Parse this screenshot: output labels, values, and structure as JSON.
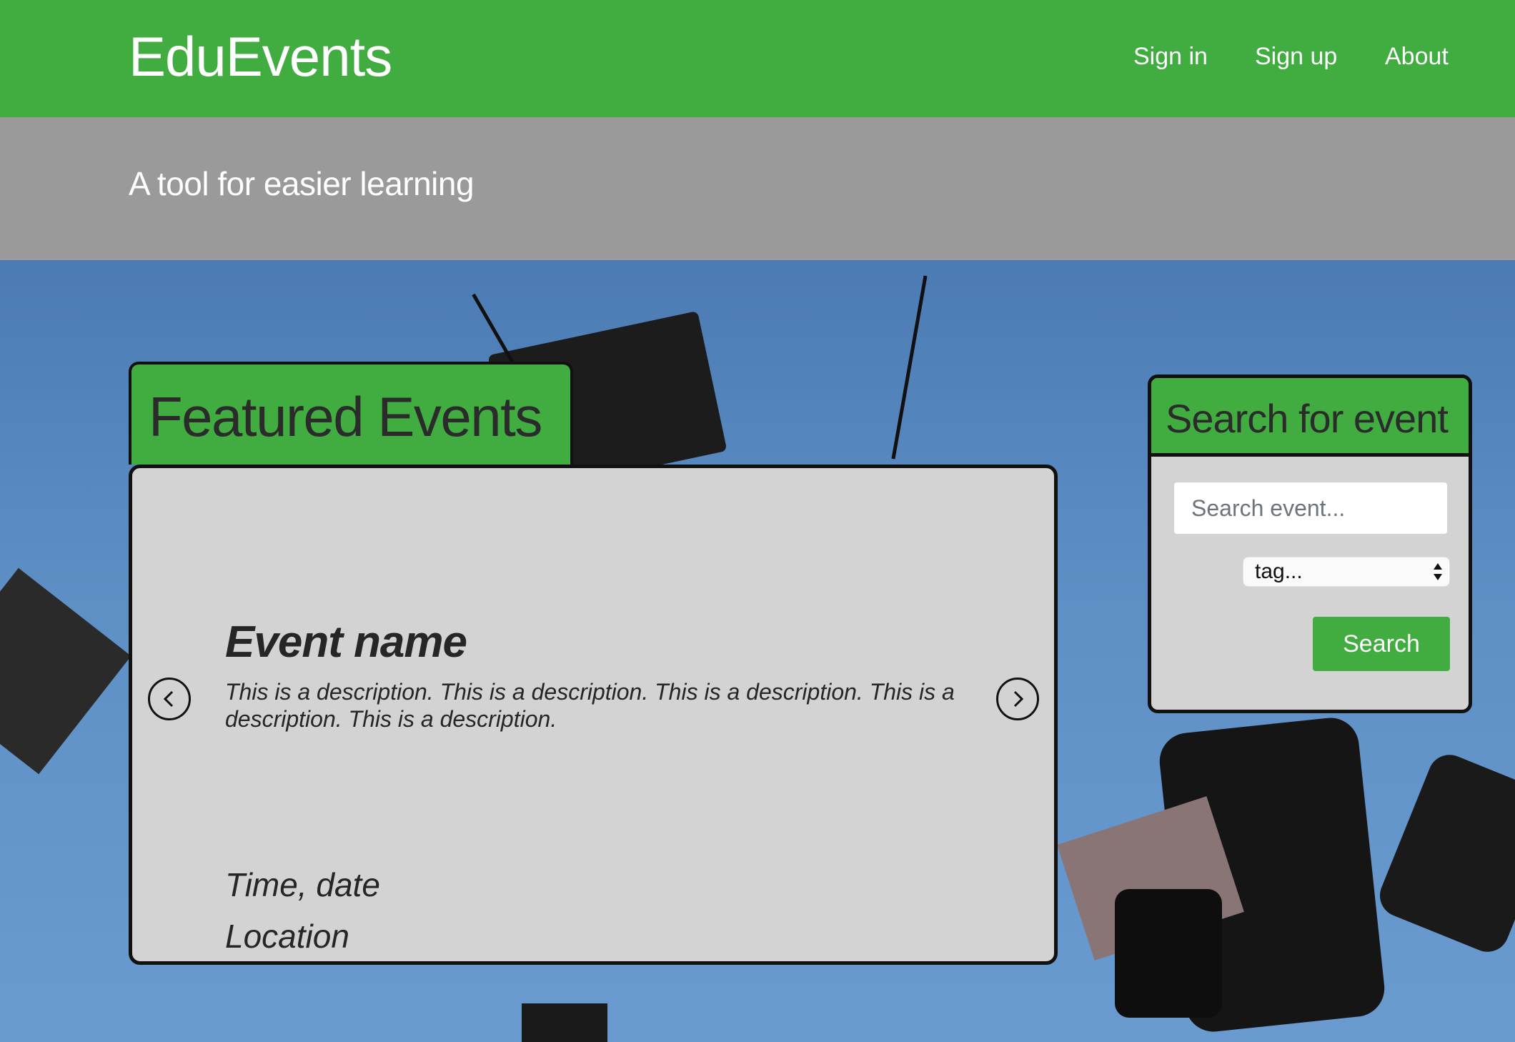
{
  "nav": {
    "brand": "EduEvents",
    "links": [
      "Sign in",
      "Sign up",
      "About"
    ]
  },
  "tagline": "A tool for easier learning",
  "featured": {
    "title": "Featured Events",
    "event": {
      "name": "Event name",
      "description": "This is a description. This is a description. This is a description. This is a description. This is a description.",
      "time": "Time, date",
      "location": "Location"
    },
    "prev_icon": "chevron-left-icon",
    "next_icon": "chevron-right-icon"
  },
  "search": {
    "title": "Search for event",
    "input_placeholder": "Search event...",
    "tag_selected": "tag...",
    "button_label": "Search"
  },
  "colors": {
    "brand_green": "#41ad41",
    "tagline_band": "#9a9a9a",
    "card_bg": "#d3d3d3"
  }
}
